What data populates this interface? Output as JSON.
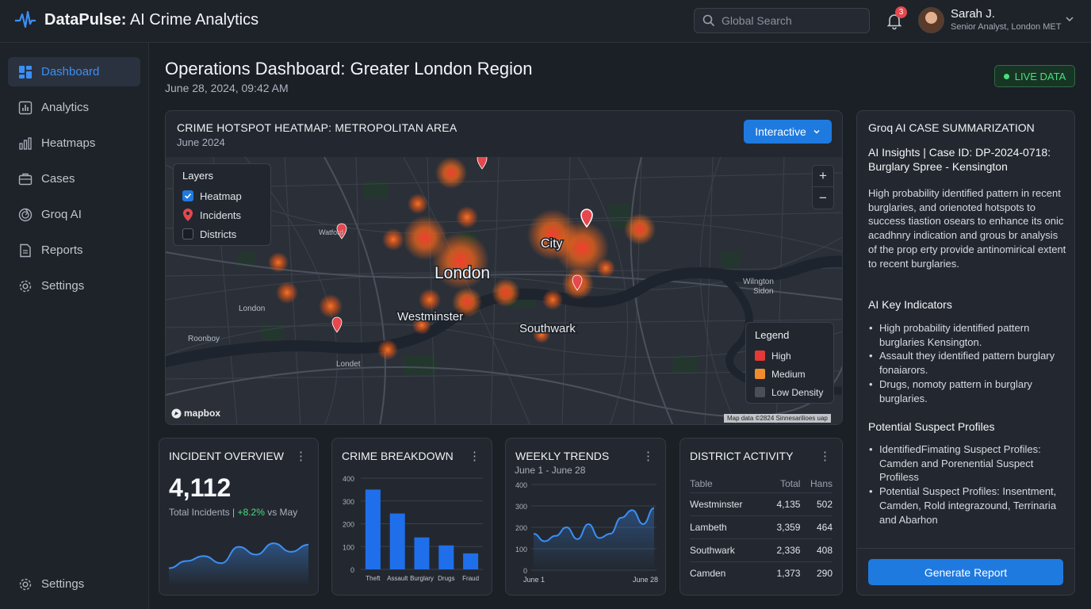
{
  "app": {
    "title_bold": "DataPulse:",
    "title_rest": " AI Crime Analytics"
  },
  "header": {
    "search_placeholder": "Global Search",
    "notification_count": "3",
    "user_name": "Sarah J.",
    "user_role": "Senior Analyst, London MET"
  },
  "sidebar": {
    "items": [
      {
        "label": "Dashboard",
        "icon": "dashboard-icon",
        "active": true
      },
      {
        "label": "Analytics",
        "icon": "analytics-icon"
      },
      {
        "label": "Heatmaps",
        "icon": "heatmaps-icon"
      },
      {
        "label": "Cases",
        "icon": "cases-icon"
      },
      {
        "label": "Groq AI",
        "icon": "groq-ai-icon"
      },
      {
        "label": "Reports",
        "icon": "reports-icon"
      },
      {
        "label": "Settings",
        "icon": "settings-icon"
      }
    ],
    "footer_label": "Settings"
  },
  "page": {
    "title": "Operations Dashboard: Greater London Region",
    "date": "June 28, 2024, 09:42 AM",
    "live_label": "LIVE DATA"
  },
  "map": {
    "title": "CRIME HOTSPOT HEATMAP: METROPOLITAN AREA",
    "subtitle": "June 2024",
    "mode_button": "Interactive",
    "layers_title": "Layers",
    "layers": [
      {
        "label": "Heatmap",
        "checked": true
      },
      {
        "label": "Incidents",
        "checked": false
      },
      {
        "label": "Districts",
        "checked": false
      }
    ],
    "legend_title": "Legend",
    "legend": [
      {
        "label": "High",
        "color": "#e53935"
      },
      {
        "label": "Medium",
        "color": "#f08c2e"
      },
      {
        "label": "Low Density",
        "color": "#4a4f58"
      }
    ],
    "places": {
      "london": "London",
      "city": "City",
      "westminster": "Westminster",
      "southwark": "Southwark",
      "wilington": "Wilngton",
      "sidon": "Sidon",
      "watford": "Watford",
      "london_small": "London",
      "roonboy": "Roonboy",
      "londet": "Londet"
    },
    "brand": "mapbox",
    "attribution": "Map data ©2824 Sinnesarilioes uap"
  },
  "incident_overview": {
    "title": "INCIDENT OVERVIEW",
    "value": "4,112",
    "label": "Total Incidents | ",
    "change": "+8.2%",
    "change_suffix": " vs May"
  },
  "chart_data": [
    {
      "type": "bar",
      "title": "CRIME BREAKDOWN",
      "categories": [
        "Theft",
        "Assault",
        "Burglary",
        "Drugs",
        "Fraud"
      ],
      "values": [
        350,
        245,
        140,
        105,
        70
      ],
      "ylim": [
        0,
        400
      ],
      "yticks": [
        0,
        100,
        200,
        300,
        400
      ],
      "color": "#1f6feb"
    },
    {
      "type": "area",
      "title": "WEEKLY TRENDS",
      "subtitle": "June 1 - June 28",
      "x_labels": [
        "June 1",
        "June 28"
      ],
      "values": [
        170,
        135,
        160,
        200,
        145,
        215,
        150,
        170,
        245,
        280,
        215,
        290
      ],
      "ylim": [
        0,
        400
      ],
      "yticks": [
        0,
        100,
        200,
        300,
        400
      ],
      "color": "#3b8ff6"
    },
    {
      "type": "area",
      "title": "INCIDENT OVERVIEW sparkline",
      "values": [
        25,
        35,
        42,
        32,
        55,
        44,
        60,
        48,
        58
      ],
      "color": "#3b8ff6"
    }
  ],
  "district_activity": {
    "title": "DISTRICT ACTIVITY",
    "columns": [
      "Table",
      "Total",
      "Hans"
    ],
    "rows": [
      [
        "Westminster",
        "4,135",
        "502"
      ],
      [
        "Lambeth",
        "3,359",
        "464"
      ],
      [
        "Southwark",
        "2,336",
        "408"
      ],
      [
        "Camden",
        "1,373",
        "290"
      ]
    ]
  },
  "ai_panel": {
    "header": "Groq AI CASE SUMMARIZATION",
    "case_title": "AI Insights | Case ID: DP-2024-0718: Burglary Spree - Kensington",
    "summary": "High probability identified pattern in recent burglaries, and orienoted hotspots to success tiastion osears to enhance its onic acadhnry indication and grous br analysis of the prop erty provide antinomirical extent to recent burglaries.",
    "indicators_title": "AI Key Indicators",
    "indicators": [
      "High probability identified pattern burglaries Kensington.",
      "Assault they identified pattern burglary fonaiarors.",
      "Drugs, nomoty pattern in burglary burglaries."
    ],
    "suspects_title": "Potential Suspect Profiles",
    "suspects": [
      "IdentifiedFimating Suspect Profiles: Camden and Porenential Suspect Profiless",
      "Potential Suspect Profiles: Insentment, Camden, Rold integrazound, Terrinaria and Abarhon"
    ],
    "button": "Generate Report"
  }
}
